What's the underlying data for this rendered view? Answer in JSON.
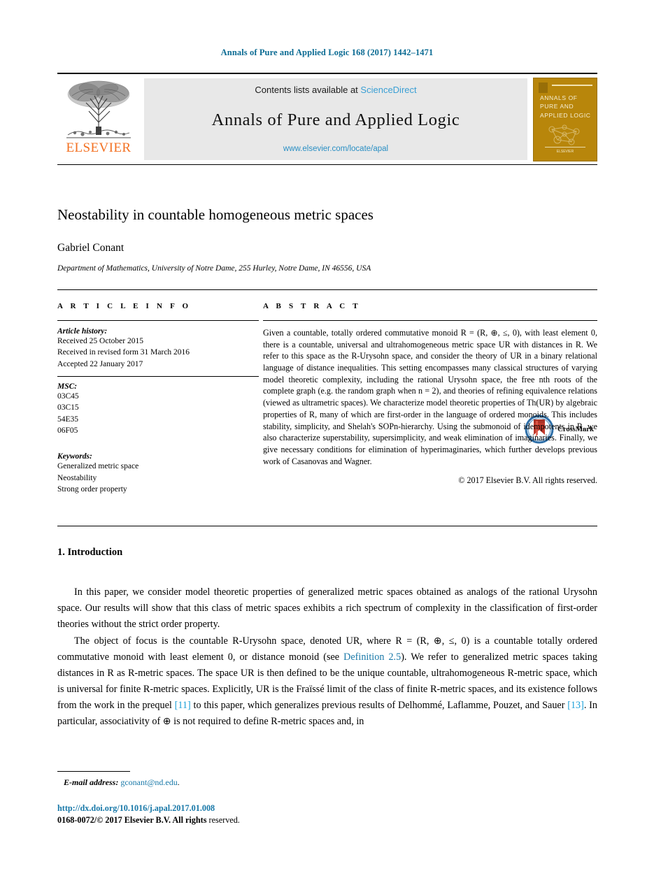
{
  "running_head": "Annals of Pure and Applied Logic 168 (2017) 1442–1471",
  "banner": {
    "publisher": "ELSEVIER",
    "contents_prefix": "Contents lists available at",
    "contents_link": "ScienceDirect",
    "journal_title": "Annals of Pure and Applied Logic",
    "journal_url": "www.elsevier.com/locate/apal",
    "cover": {
      "title": "ANNALS OF\nPURE AND\nAPPLIED LOGIC",
      "footer": "ELSEVIER"
    }
  },
  "article": {
    "title": "Neostability in countable homogeneous metric spaces",
    "author": "Gabriel Conant",
    "affiliation": "Department of Mathematics, University of Notre Dame, 255 Hurley, Notre Dame, IN 46556, USA",
    "crossmark_label": "CrossMark"
  },
  "info": {
    "heading": "A R T I C L E   I N F O",
    "history_label": "Article history:",
    "history": [
      "Received 25 October 2015",
      "Received in revised form 31 March 2016",
      "Accepted 22 January 2017"
    ],
    "msc_label": "MSC:",
    "msc": [
      "03C45",
      "03C15",
      "54E35",
      "06F05"
    ],
    "keywords_label": "Keywords:",
    "keywords": [
      "Generalized metric space",
      "Neostability",
      "Strong order property"
    ]
  },
  "abstract": {
    "heading": "A B S T R A C T",
    "text": "Given a countable, totally ordered commutative monoid R = (R, ⊕, ≤, 0), with least element 0, there is a countable, universal and ultrahomogeneous metric space UR with distances in R. We refer to this space as the R-Urysohn space, and consider the theory of UR in a binary relational language of distance inequalities. This setting encompasses many classical structures of varying model theoretic complexity, including the rational Urysohn space, the free nth roots of the complete graph (e.g. the random graph when n = 2), and theories of refining equivalence relations (viewed as ultrametric spaces). We characterize model theoretic properties of Th(UR) by algebraic properties of R, many of which are first-order in the language of ordered monoids. This includes stability, simplicity, and Shelah's SOPn-hierarchy. Using the submonoid of idempotents in R, we also characterize superstability, supersimplicity, and weak elimination of imaginaries. Finally, we give necessary conditions for elimination of hyperimaginaries, which further develops previous work of Casanovas and Wagner.",
    "copyright": "© 2017 Elsevier B.V. All rights reserved."
  },
  "body": {
    "section_number_title": "1.  Introduction",
    "paragraph_1": "In this paper, we consider model theoretic properties of generalized metric spaces obtained as analogs of the rational Urysohn space. Our results will show that this class of metric spaces exhibits a rich spectrum of complexity in the classification of first-order theories without the strict order property.",
    "paragraph_2_parts": {
      "a": "The object of focus is the countable R-Urysohn space, denoted UR, where R = (R, ⊕, ≤, 0) is a countable totally ordered commutative monoid with least element 0, or distance monoid (see ",
      "link_definition": "Definition 2.5",
      "b": "). We refer to generalized metric spaces taking distances in R as R-metric spaces. The space UR is then defined to be the unique countable, ultrahomogeneous R-metric space, which is universal for finite R-metric spaces. Explicitly, UR is the Fraïssé limit of the class of finite R-metric spaces, and its existence follows from the work in the prequel ",
      "ref_11": "[11]",
      "c": " to this paper, which generalizes previous results of Delhommé, Laflamme, Pouzet, and Sauer ",
      "ref_13": "[13]",
      "d": ". In particular, associativity of ⊕ is not required to define R-metric spaces and, in"
    }
  },
  "footer": {
    "email_label": "E-mail address:",
    "email": "gconant@nd.edu",
    "email_period": ".",
    "doi": "http://dx.doi.org/10.1016/j.apal.2017.01.008",
    "issn_line": "0168-0072/© 2017 Elsevier B.V. All rights reserved.",
    "issn_bold": "0168-0072/© 2017 Elsevier B.V. All rights",
    "issn_norm": " reserved."
  },
  "colors": {
    "link_blue": "#1878a8",
    "sciencedirect_blue": "#3a9fd4",
    "elsevier_orange": "#F37021",
    "cover_gold": "#b8860b",
    "ref_blue": "#1ba0d8"
  }
}
